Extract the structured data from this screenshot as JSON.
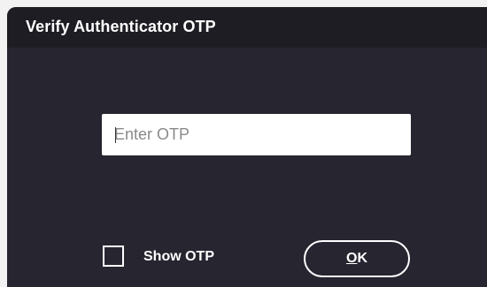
{
  "dialog": {
    "title": "Verify Authenticator OTP",
    "otp_input": {
      "placeholder": "Enter OTP",
      "value": ""
    },
    "show_otp": {
      "label": "Show OTP",
      "checked": false
    },
    "ok_button": {
      "mnemonic": "O",
      "rest": "K"
    }
  },
  "colors": {
    "window_bg": "#272530",
    "titlebar_bg": "#1e1d23",
    "text": "#ffffff",
    "input_bg": "#ffffff"
  }
}
